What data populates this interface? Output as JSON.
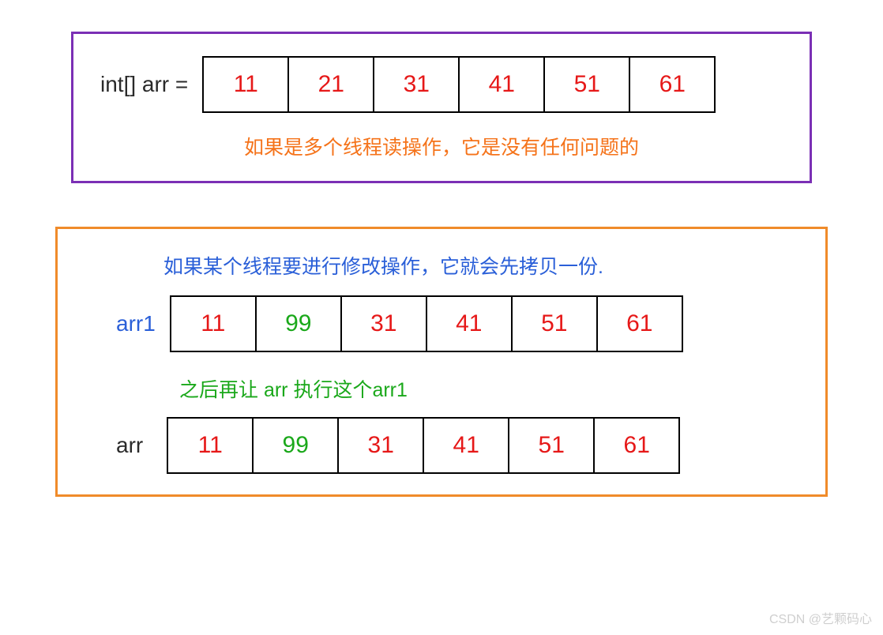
{
  "panel1": {
    "label": "int[] arr =",
    "values": [
      "11",
      "21",
      "31",
      "41",
      "51",
      "61"
    ],
    "caption": "如果是多个线程读操作，它是没有任何问题的"
  },
  "panel2": {
    "caption_top": "如果某个线程要进行修改操作，它就会先拷贝一份.",
    "arr1_label": "arr1",
    "arr1_values": [
      "11",
      "99",
      "31",
      "41",
      "51",
      "61"
    ],
    "arr1_mod_index": 1,
    "caption_mid": "之后再让 arr 执行这个arr1",
    "arr_label": "arr",
    "arr_values": [
      "11",
      "99",
      "31",
      "41",
      "51",
      "61"
    ],
    "arr_mod_index": 1
  },
  "watermark": "CSDN @艺颗码心",
  "colors": {
    "purple_border": "#7b2fb5",
    "orange_border": "#f08b2a",
    "red_value": "#e61818",
    "green_value": "#1aa81a",
    "blue_text": "#2a5fd8",
    "orange_text": "#f5731a"
  },
  "chart_data": {
    "type": "table",
    "title": "CopyOnWrite array diagram",
    "arrays": [
      {
        "name": "arr (initial)",
        "values": [
          11,
          21,
          31,
          41,
          51,
          61
        ]
      },
      {
        "name": "arr1 (copy, modified index 1)",
        "values": [
          11,
          99,
          31,
          41,
          51,
          61
        ]
      },
      {
        "name": "arr (after reassignment)",
        "values": [
          11,
          99,
          31,
          41,
          51,
          61
        ]
      }
    ],
    "annotations": [
      "如果是多个线程读操作，它是没有任何问题的",
      "如果某个线程要进行修改操作，它就会先拷贝一份.",
      "之后再让 arr 执行这个arr1"
    ]
  }
}
